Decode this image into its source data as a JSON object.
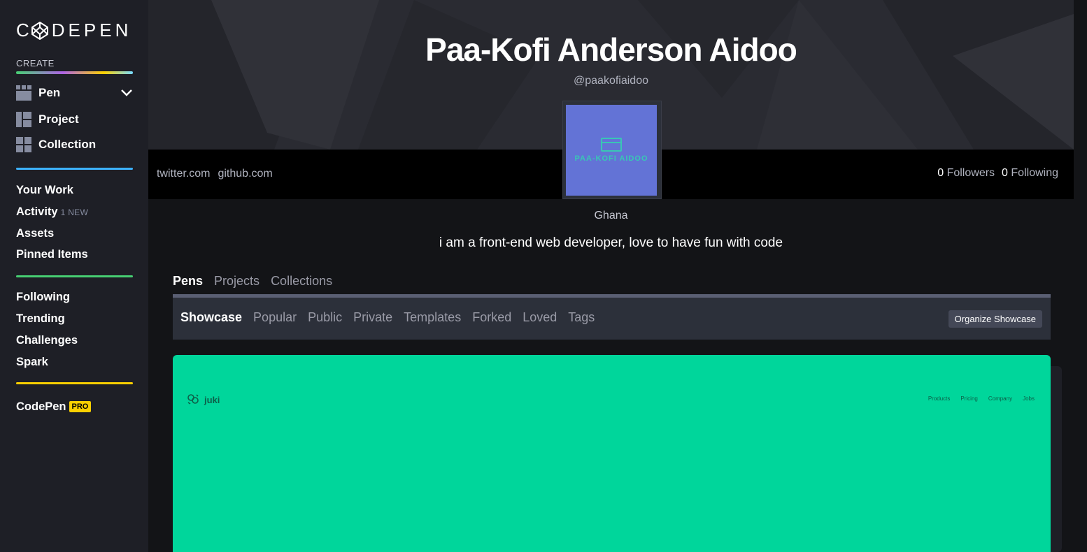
{
  "sidebar": {
    "logo_text": "DEPEN",
    "logo_letter": "C",
    "create_label": "CREATE",
    "create_items": [
      {
        "label": "Pen",
        "icon": "pen-grid-icon"
      },
      {
        "label": "Project",
        "icon": "project-layout-icon"
      },
      {
        "label": "Collection",
        "icon": "collection-grid-icon"
      }
    ],
    "nav_group_1": [
      {
        "label": "Your Work"
      },
      {
        "label": "Activity",
        "badge": "1 NEW"
      },
      {
        "label": "Assets"
      },
      {
        "label": "Pinned Items"
      }
    ],
    "nav_group_2": [
      {
        "label": "Following"
      },
      {
        "label": "Trending"
      },
      {
        "label": "Challenges"
      },
      {
        "label": "Spark"
      }
    ],
    "codepen_pro": {
      "label": "CodePen",
      "badge": "PRO"
    },
    "separator_colors": [
      "#3db2ff",
      "#47cf73",
      "#fcd000"
    ]
  },
  "profile": {
    "name": "Paa-Kofi Anderson Aidoo",
    "handle": "@paakofiaidoo",
    "avatar_text": "PAA-KOFI AIDOO",
    "links": [
      "twitter.com",
      "github.com"
    ],
    "followers_count": "0",
    "followers_label": "Followers",
    "following_count": "0",
    "following_label": "Following",
    "location": "Ghana",
    "bio": "i am a front-end web developer, love to have fun with code"
  },
  "tabs": [
    "Pens",
    "Projects",
    "Collections"
  ],
  "active_tab": "Pens",
  "subtabs": [
    "Showcase",
    "Popular",
    "Public",
    "Private",
    "Templates",
    "Forked",
    "Loved",
    "Tags"
  ],
  "active_subtab": "Showcase",
  "organize_button": "Organize Showcase",
  "preview": {
    "brand": "juki",
    "menu": [
      "Products",
      "Pricing",
      "Company",
      "Jobs"
    ],
    "background": "#00d69b"
  }
}
